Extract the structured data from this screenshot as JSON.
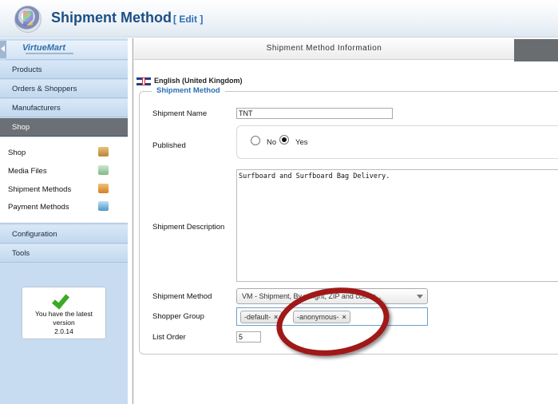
{
  "header": {
    "title": "Shipment Method",
    "edit": "[ Edit ]"
  },
  "sidebar": {
    "logo": "VirtueMart",
    "top_items": [
      "Products",
      "Orders & Shoppers",
      "Manufacturers",
      "Shop"
    ],
    "sub_items": [
      {
        "label": "Shop",
        "icon": "shop-icon"
      },
      {
        "label": "Media Files",
        "icon": "media-icon"
      },
      {
        "label": "Shipment Methods",
        "icon": "truck-icon"
      },
      {
        "label": "Payment Methods",
        "icon": "payment-icon"
      }
    ],
    "bottom_items": [
      "Configuration",
      "Tools"
    ],
    "version": {
      "line1": "You have the latest",
      "line2": "version",
      "line3": "2.0.14"
    }
  },
  "panel": {
    "heading": "Shipment Method Information",
    "language": "English (United Kingdom)",
    "legend": "Shipment Method"
  },
  "form": {
    "name_label": "Shipment Name",
    "name_value": "TNT",
    "published_label": "Published",
    "no_label": "No",
    "yes_label": "Yes",
    "published_value": "Yes",
    "description_label": "Shipment Description",
    "description_value": "Surfboard and Surfboard Bag Delivery.",
    "method_label": "Shipment Method",
    "method_value": "VM - Shipment, By weight, ZIP and countr...",
    "group_label": "Shopper Group",
    "group_chips": [
      "-default-",
      "-anonymous-"
    ],
    "order_label": "List Order",
    "order_value": "5"
  },
  "colors": {
    "accent": "#2a6fb5",
    "highlight_ring": "#a01818",
    "active_menu": "#6a7075"
  }
}
